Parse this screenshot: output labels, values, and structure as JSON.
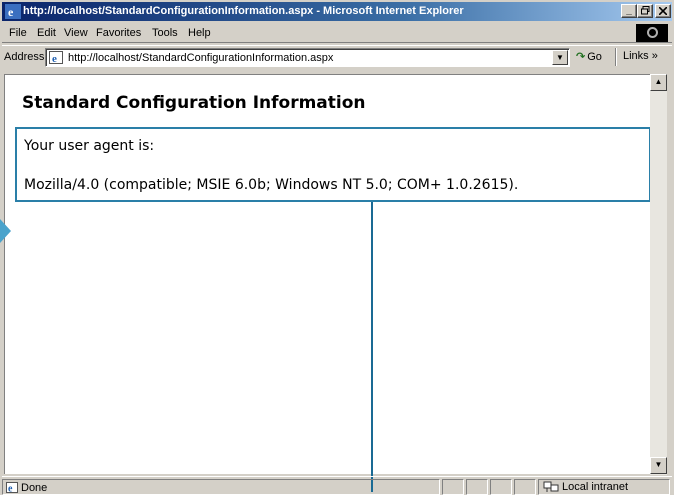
{
  "window": {
    "title": "http://localhost/StandardConfigurationInformation.aspx - Microsoft Internet Explorer",
    "min_label": "_",
    "max_label": "&#9633;",
    "close_label": "x"
  },
  "menu": {
    "items": [
      "File",
      "Edit",
      "View",
      "Favorites",
      "Tools",
      "Help"
    ]
  },
  "address": {
    "label": "Address",
    "url": "http://localhost/StandardConfigurationInformation.aspx",
    "go_label": "Go",
    "links_label": "Links »"
  },
  "page": {
    "title": "Standard Configuration Information",
    "agent_label": "Your user agent is:",
    "agent_value": "Mozilla/4.0 (compatible; MSIE 6.0b; Windows NT 5.0; COM+ 1.0.2615)."
  },
  "status": {
    "text": "Done",
    "zone": "Local intranet"
  },
  "colors": {
    "title_gradient_start": "#0a246a",
    "callout": "#2a7fa8"
  }
}
